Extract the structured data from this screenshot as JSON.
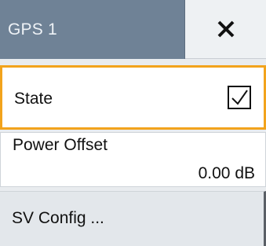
{
  "header": {
    "title": "GPS 1",
    "close_icon": "close-icon"
  },
  "state_row": {
    "label": "State",
    "checked": true,
    "checkbox_icon": "checkmark-icon"
  },
  "power_offset": {
    "label": "Power Offset",
    "value": "0.00",
    "unit": "dB"
  },
  "sv_config": {
    "label": "SV Config ..."
  },
  "colors": {
    "header_bg": "#6f8296",
    "focus_border": "#f2a31c",
    "panel_bg": "#e9ecef"
  }
}
